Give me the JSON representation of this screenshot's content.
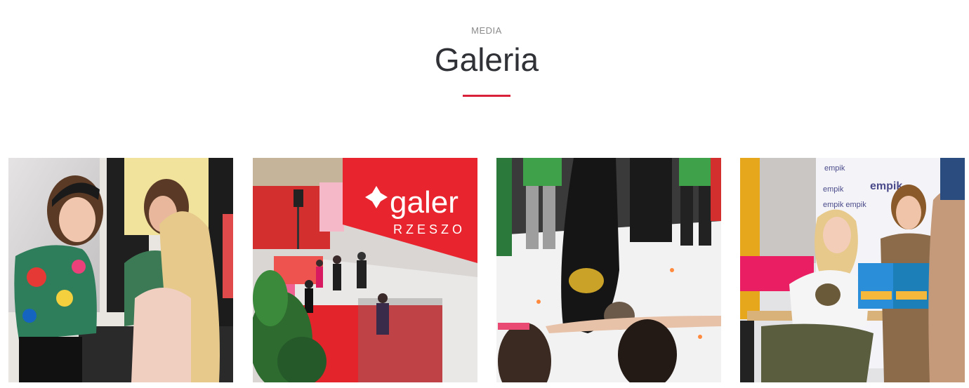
{
  "section": {
    "eyebrow": "MEDIA",
    "title": "Galeria",
    "accent_color": "#d9223a"
  },
  "gallery": {
    "items": [
      {
        "name": "makeup-photo",
        "alt": ""
      },
      {
        "name": "mall-event-photo",
        "alt": ""
      },
      {
        "name": "breakdance-photo",
        "alt": ""
      },
      {
        "name": "book-signing-photo",
        "alt": ""
      }
    ],
    "banner_text": "galer",
    "banner_subtext": "RZESZO",
    "sign_text": "empik"
  }
}
